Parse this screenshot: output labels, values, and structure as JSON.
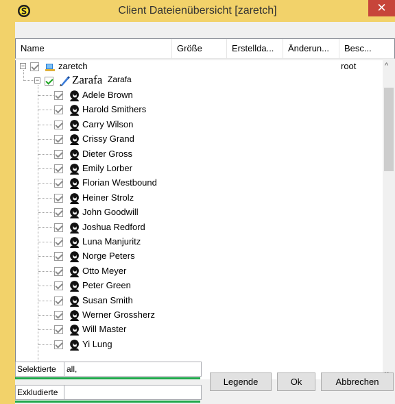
{
  "window": {
    "title": "Client Dateienübersicht [zaretch]",
    "close_label": "✕"
  },
  "header": {
    "columns": [
      "Name",
      "Größe",
      "Erstellda...",
      "Änderun...",
      "Besc..."
    ]
  },
  "tree": {
    "root": {
      "label": "zaretch",
      "description": "root"
    },
    "child": {
      "logo_text": "Zarafa",
      "label": "Zarafa"
    },
    "users": [
      "Adele Brown",
      "Harold Smithers",
      "Carry Wilson",
      "Crissy Grand",
      "Dieter Gross",
      "Emily Lorber",
      "Florian Westbound",
      "Heiner Strolz",
      "John Goodwill",
      "Joshua Redford",
      "Luna Manjuritz",
      "Norge Peters",
      "Otto Meyer",
      "Peter Green",
      "Susan Smith",
      "Werner Grossherz",
      "Will Master",
      "Yi Lung"
    ]
  },
  "scrollbar": {
    "up": "^",
    "down": "v"
  },
  "bottom": {
    "selected_label": "Selektierte",
    "selected_value": "all,",
    "excluded_label": "Exkludierte",
    "excluded_value": "",
    "legend_button": "Legende",
    "ok_button": "Ok",
    "cancel_button": "Abbrechen"
  },
  "colors": {
    "title_bg": "#f2d26a",
    "close_bg": "#c7453a",
    "check_green": "#19a31e",
    "progress_green": "#1ea84a"
  }
}
